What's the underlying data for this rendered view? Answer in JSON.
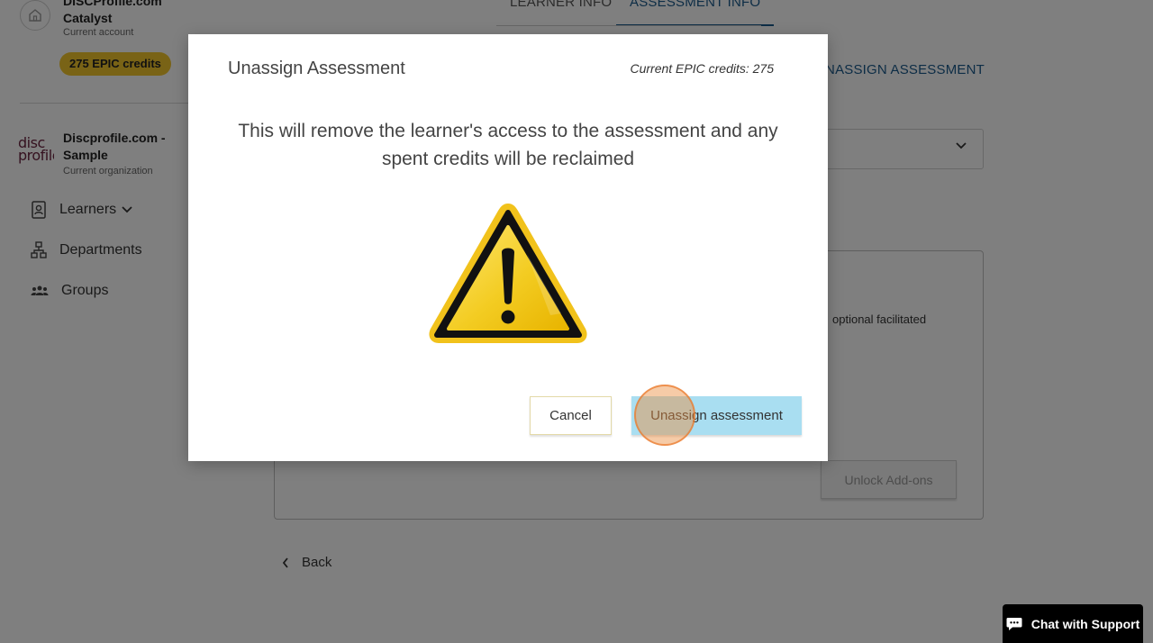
{
  "sidebar": {
    "account": {
      "name_line1": "DISCProfile.com",
      "name_line2": "Catalyst",
      "subtitle": "Current account"
    },
    "credits_badge": "275 EPIC credits",
    "organization": {
      "logo_text_line1": "disc",
      "logo_text_line2": "profile",
      "name_line1": "Discprofile.com -",
      "name_line2": "Sample",
      "subtitle": "Current organization"
    },
    "nav": [
      {
        "label": "Learners",
        "icon": "person-badge-icon",
        "has_dropdown": true
      },
      {
        "label": "Departments",
        "icon": "org-chart-icon"
      },
      {
        "label": "Groups",
        "icon": "group-icon"
      }
    ]
  },
  "main": {
    "tabs": [
      {
        "label": "LEARNER INFO",
        "active": false
      },
      {
        "label": "ASSESSMENT INFO",
        "active": true
      }
    ],
    "unassign_link": "UNASSIGN ASSESSMENT",
    "card_text_fragment": "optional facilitated",
    "unlock_button": "Unlock Add-ons",
    "back_link": "Back"
  },
  "modal": {
    "title": "Unassign Assessment",
    "credits_label": "Current EPIC credits: 275",
    "message": "This will remove the learner's access to the assessment and any spent credits will be reclaimed",
    "warning_icon": "warning-triangle-icon",
    "cancel_label": "Cancel",
    "confirm_label": "Unassign assessment"
  },
  "chat": {
    "label": "Chat with Support",
    "icon": "chat-bubble-icon"
  },
  "colors": {
    "accent": "#1a5a8c",
    "credits_badge": "#f2c62d",
    "confirm_button": "#a9def1",
    "warning_yellow": "#f3cc22"
  }
}
